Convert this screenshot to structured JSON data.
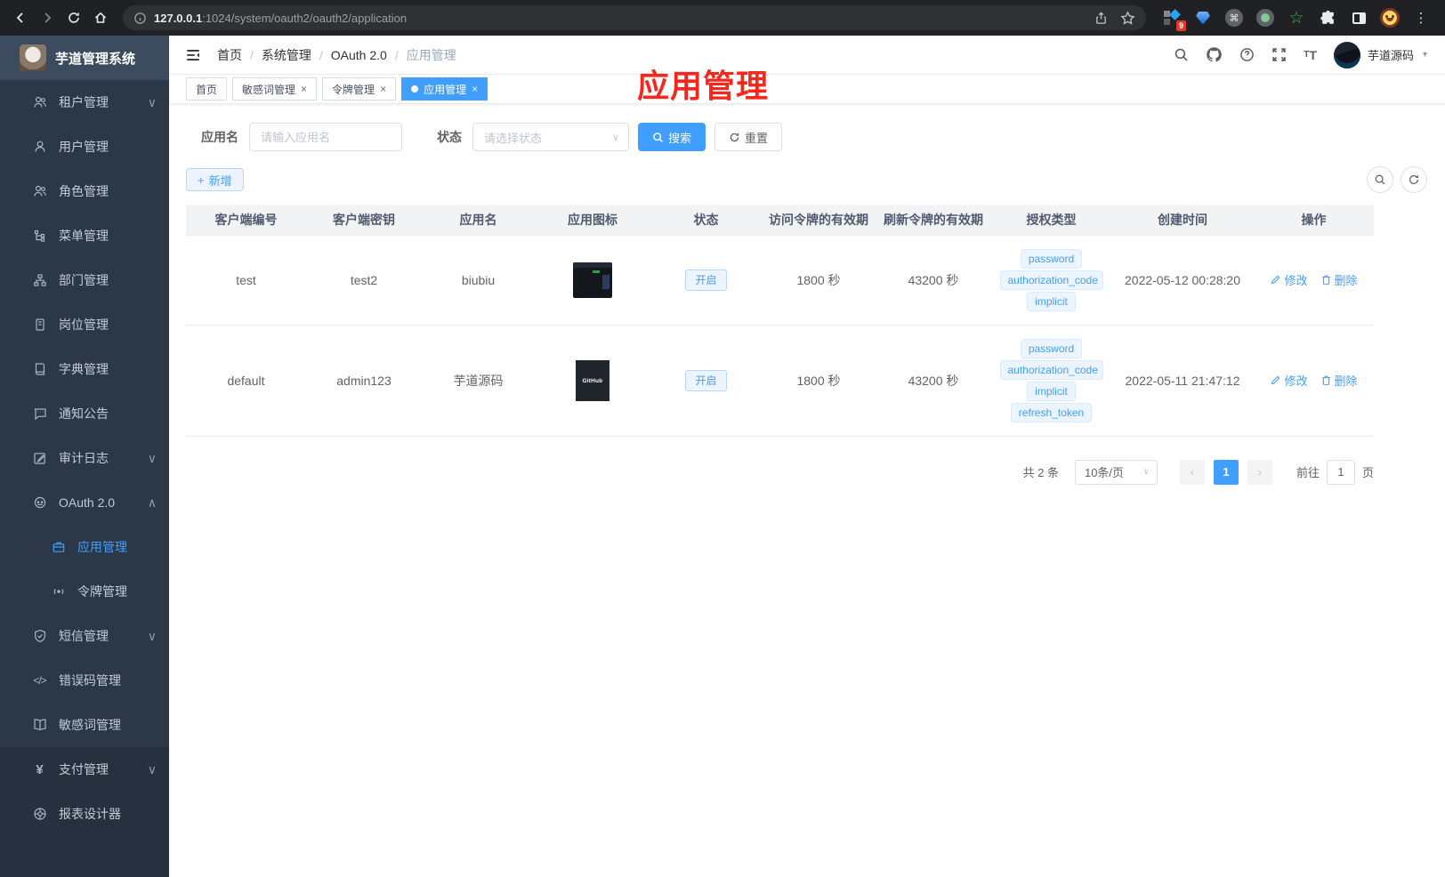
{
  "browser": {
    "url_host": "127.0.0.1",
    "url_path": ":1024/system/oauth2/oauth2/application",
    "extension_badge": "9"
  },
  "sidebar": {
    "app_title": "芋道管理系统",
    "items": [
      {
        "icon": "tenants-icon",
        "label": "租户管理",
        "chevron": "down",
        "child": false,
        "active": false,
        "section2": false
      },
      {
        "icon": "user-icon",
        "label": "用户管理",
        "chevron": null,
        "child": false,
        "active": false,
        "section2": false
      },
      {
        "icon": "roles-icon",
        "label": "角色管理",
        "chevron": null,
        "child": false,
        "active": false,
        "section2": false
      },
      {
        "icon": "menu-tree-icon",
        "label": "菜单管理",
        "chevron": null,
        "child": false,
        "active": false,
        "section2": false
      },
      {
        "icon": "org-icon",
        "label": "部门管理",
        "chevron": null,
        "child": false,
        "active": false,
        "section2": false
      },
      {
        "icon": "post-icon",
        "label": "岗位管理",
        "chevron": null,
        "child": false,
        "active": false,
        "section2": false
      },
      {
        "icon": "dict-icon",
        "label": "字典管理",
        "chevron": null,
        "child": false,
        "active": false,
        "section2": false
      },
      {
        "icon": "notice-icon",
        "label": "通知公告",
        "chevron": null,
        "child": false,
        "active": false,
        "section2": false
      },
      {
        "icon": "audit-icon",
        "label": "审计日志",
        "chevron": "down",
        "child": false,
        "active": false,
        "section2": false
      },
      {
        "icon": "oauth-icon",
        "label": "OAuth 2.0",
        "chevron": "up",
        "child": false,
        "active": false,
        "section2": false
      },
      {
        "icon": "briefcase-icon",
        "label": "应用管理",
        "chevron": null,
        "child": true,
        "active": true,
        "section2": false
      },
      {
        "icon": "signal-icon",
        "label": "令牌管理",
        "chevron": null,
        "child": true,
        "active": false,
        "section2": false
      },
      {
        "icon": "shield-icon",
        "label": "短信管理",
        "chevron": "down",
        "child": false,
        "active": false,
        "section2": false
      },
      {
        "icon": "code-icon",
        "label": "错误码管理",
        "chevron": null,
        "child": false,
        "active": false,
        "section2": false
      },
      {
        "icon": "book-icon",
        "label": "敏感词管理",
        "chevron": null,
        "child": false,
        "active": false,
        "section2": false
      },
      {
        "icon": "yen-icon",
        "label": "支付管理",
        "chevron": "down",
        "child": false,
        "active": false,
        "section2": true
      },
      {
        "icon": "report-icon",
        "label": "报表设计器",
        "chevron": null,
        "child": false,
        "active": false,
        "section2": true
      }
    ]
  },
  "topbar": {
    "breadcrumb": [
      "首页",
      "系统管理",
      "OAuth 2.0",
      "应用管理"
    ],
    "username": "芋道源码"
  },
  "tabs": [
    {
      "label": "首页",
      "closable": false,
      "active": false
    },
    {
      "label": "敏感词管理",
      "closable": true,
      "active": false
    },
    {
      "label": "令牌管理",
      "closable": true,
      "active": false
    },
    {
      "label": "应用管理",
      "closable": true,
      "active": true
    }
  ],
  "annotation": {
    "text": "应用管理",
    "color": "#f5271d"
  },
  "filter": {
    "name_label": "应用名",
    "name_placeholder": "请输入应用名",
    "status_label": "状态",
    "status_placeholder": "请选择状态",
    "search_label": "搜索",
    "reset_label": "重置"
  },
  "toolbar": {
    "add_label": "新增"
  },
  "table": {
    "columns": [
      "客户端编号",
      "客户端密钥",
      "应用名",
      "应用图标",
      "状态",
      "访问令牌的有效期",
      "刷新令牌的有效期",
      "授权类型",
      "创建时间",
      "操作"
    ],
    "edit_label": "修改",
    "delete_label": "删除",
    "rows": [
      {
        "client_id": "test",
        "secret": "test2",
        "name": "biubiu",
        "icon_style": "screenshot",
        "icon_text": "",
        "status": "开启",
        "access_validity": "1800 秒",
        "refresh_validity": "43200 秒",
        "grant_types": [
          "password",
          "authorization_code",
          "implicit"
        ],
        "create_time": "2022-05-12 00:28:20"
      },
      {
        "client_id": "default",
        "secret": "admin123",
        "name": "芋道源码",
        "icon_style": "github",
        "icon_text": "GitHub",
        "status": "开启",
        "access_validity": "1800 秒",
        "refresh_validity": "43200 秒",
        "grant_types": [
          "password",
          "authorization_code",
          "implicit",
          "refresh_token"
        ],
        "create_time": "2022-05-11 21:47:12"
      }
    ]
  },
  "pagination": {
    "total_label": "共 2 条",
    "page_size": "10条/页",
    "current_page": "1",
    "goto_label": "前往",
    "goto_value": "1",
    "page_label": "页"
  },
  "colors": {
    "accent": "#409eff",
    "annotation_red": "#f5271d",
    "sidebar_bg": "#2c3848"
  }
}
